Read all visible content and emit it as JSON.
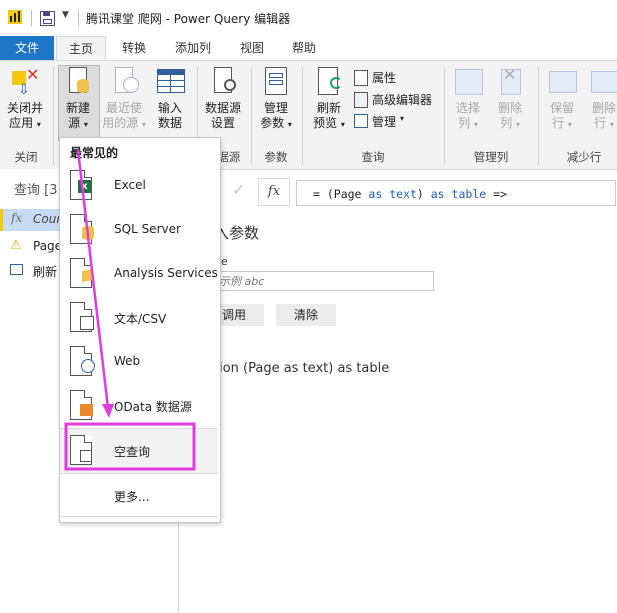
{
  "window": {
    "title": "腾讯课堂 爬网 - Power Query 编辑器"
  },
  "tabs": [
    {
      "label": "文件"
    },
    {
      "label": "主页"
    },
    {
      "label": "转换"
    },
    {
      "label": "添加列"
    },
    {
      "label": "视图"
    },
    {
      "label": "帮助"
    }
  ],
  "ribbon": {
    "close": {
      "label_line1": "关闭并",
      "label_line2": "应用",
      "group": "关闭"
    },
    "new_source": {
      "label_line1": "新建",
      "label_line2": "源"
    },
    "recent_sources": {
      "label_line1": "最近使",
      "label_line2": "用的源"
    },
    "enter_data": {
      "label_line1": "输入",
      "label_line2": "数据"
    },
    "data_source_settings": {
      "label_line1": "数据源",
      "label_line2": "设置",
      "group": "数据源"
    },
    "manage_params": {
      "label_line1": "管理",
      "label_line2": "参数",
      "group": "参数"
    },
    "refresh_preview": {
      "label_line1": "刷新",
      "label_line2": "预览"
    },
    "properties": "属性",
    "advanced_editor": "高级编辑器",
    "manage": "管理",
    "query_group": "查询",
    "choose_cols": {
      "label_line1": "选择",
      "label_line2": "列"
    },
    "remove_cols": {
      "label_line1": "删除",
      "label_line2": "列"
    },
    "manage_cols_group": "管理列",
    "keep_rows": {
      "label_line1": "保留",
      "label_line2": "行"
    },
    "remove_rows": {
      "label_line1": "删除",
      "label_line2": "行"
    },
    "reduce_rows_group": "减少行"
  },
  "left_panel": {
    "header": "查询 [3",
    "items": [
      {
        "label": "Cour"
      },
      {
        "label": "Page"
      },
      {
        "label": "刷新"
      }
    ]
  },
  "formula": {
    "fx": "fx",
    "text_prefix": "= (Page ",
    "kw_as1": "as",
    "kw_text": "text",
    "text_mid": ") ",
    "kw_as2": "as",
    "kw_table": "table",
    "text_suffix": " =>"
  },
  "main": {
    "heading": "入参数",
    "param_label": "ge",
    "param_placeholder": "示例 abc",
    "invoke_label": "调用",
    "clear_label": "清除",
    "function_sig": "tion (Page as text) as table"
  },
  "menu": {
    "header": "最常见的",
    "items": [
      {
        "label": "Excel"
      },
      {
        "label": "SQL Server"
      },
      {
        "label": "Analysis Services"
      },
      {
        "label": "文本/CSV"
      },
      {
        "label": "Web"
      },
      {
        "label": "OData 数据源"
      },
      {
        "label": "空查询"
      }
    ],
    "more": "更多..."
  },
  "colors": {
    "file_tab": "#1f76c8",
    "annotation": "#e23be0",
    "excel_green": "#1f7246"
  }
}
